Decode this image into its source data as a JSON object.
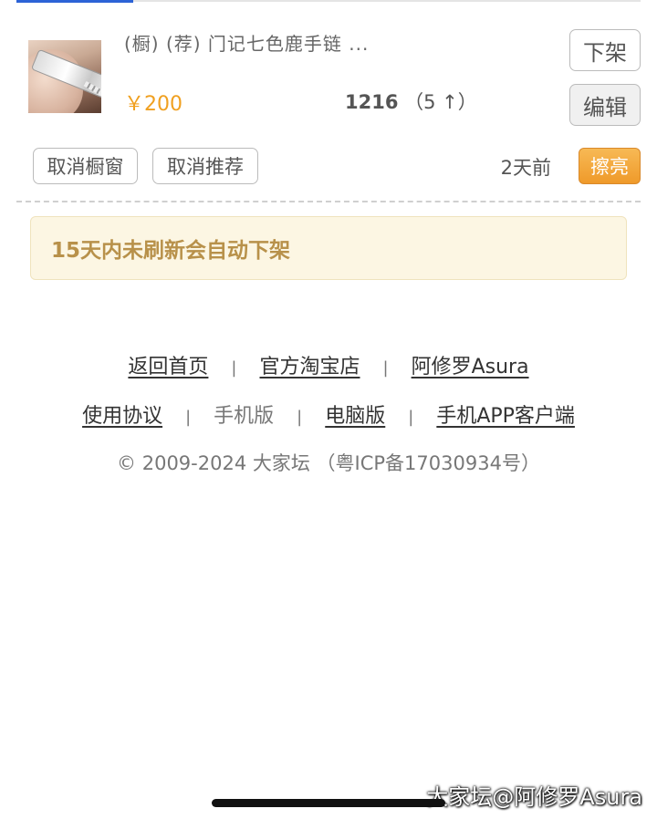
{
  "item": {
    "title": "(橱) (荐) 门记七色鹿手链 ...",
    "price": "￥200",
    "view_count": "1216",
    "view_increase": "（5 ↑）",
    "offline_label": "下架",
    "edit_label": "编辑",
    "cancel_window_label": "取消橱窗",
    "cancel_recommend_label": "取消推荐",
    "time_ago": "2天前",
    "refresh_label": "擦亮"
  },
  "notice": "15天内未刷新会自动下架",
  "footer": {
    "row1": [
      "返回首页",
      "官方淘宝店",
      "阿修罗Asura"
    ],
    "row2_links": [
      "使用协议",
      "手机版",
      "电脑版",
      "手机APP客户端"
    ],
    "separator": "|",
    "copyright": "© 2009-2024 大家坛 （粤ICP备17030934号）"
  },
  "watermark": "大家坛@阿修罗Asura",
  "colors": {
    "accent_orange": "#f0a020",
    "notice_bg": "#fcf6e3",
    "notice_text": "#b8914a",
    "tab_active": "#2c63d6"
  }
}
